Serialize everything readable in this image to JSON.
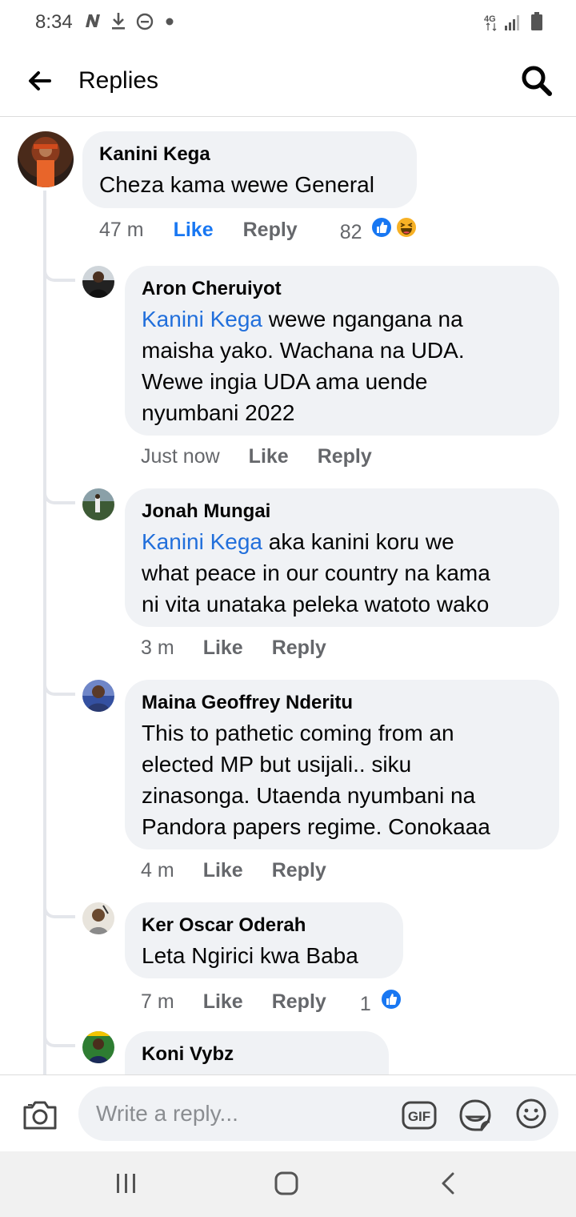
{
  "status_bar": {
    "time": "8:34",
    "icons": [
      "n-icon",
      "download-icon",
      "do-not-disturb-icon",
      "dot-icon"
    ],
    "network": "4G"
  },
  "header": {
    "title": "Replies",
    "back_icon": "arrow-left-icon",
    "search_icon": "search-icon"
  },
  "main_comment": {
    "author": "Kanini Kega",
    "text": "Cheza kama wewe General",
    "time": "47 m",
    "like_label": "Like",
    "reply_label": "Reply",
    "reaction_count": "82",
    "reactions": [
      "like",
      "haha"
    ]
  },
  "replies": [
    {
      "author": "Aron Cheruiyot",
      "tag": "Kanini Kega",
      "lines": [
        " wewe ngangana na",
        "maisha yako. Wachana na UDA.",
        "Wewe ingia UDA ama uende",
        "nyumbani 2022"
      ],
      "time": "Just now",
      "like_label": "Like",
      "reply_label": "Reply"
    },
    {
      "author": "Jonah Mungai",
      "tag": "Kanini Kega",
      "lines": [
        " aka kanini koru we",
        "what peace in our country na kama",
        "ni vita unataka peleka watoto wako"
      ],
      "time": "3 m",
      "like_label": "Like",
      "reply_label": "Reply"
    },
    {
      "author": "Maina Geoffrey Nderitu",
      "lines": [
        "This to pathetic coming from an",
        "elected MP but usijali.. siku",
        "zinasonga. Utaenda nyumbani na",
        "Pandora papers regime. Conokaaa"
      ],
      "time": "4 m",
      "like_label": "Like",
      "reply_label": "Reply"
    },
    {
      "author": "Ker Oscar Oderah",
      "lines": [
        "Leta Ngirici kwa Baba"
      ],
      "time": "7 m",
      "like_label": "Like",
      "reply_label": "Reply",
      "reaction_count": "1",
      "reactions": [
        "like"
      ]
    },
    {
      "author": "Koni Vybz"
    }
  ],
  "composer": {
    "placeholder": "Write a reply...",
    "gif_label": "GIF"
  },
  "colors": {
    "accent": "#1877f2",
    "bubble": "#f0f2f5",
    "muted": "#65676b",
    "tag": "#216fdb"
  }
}
